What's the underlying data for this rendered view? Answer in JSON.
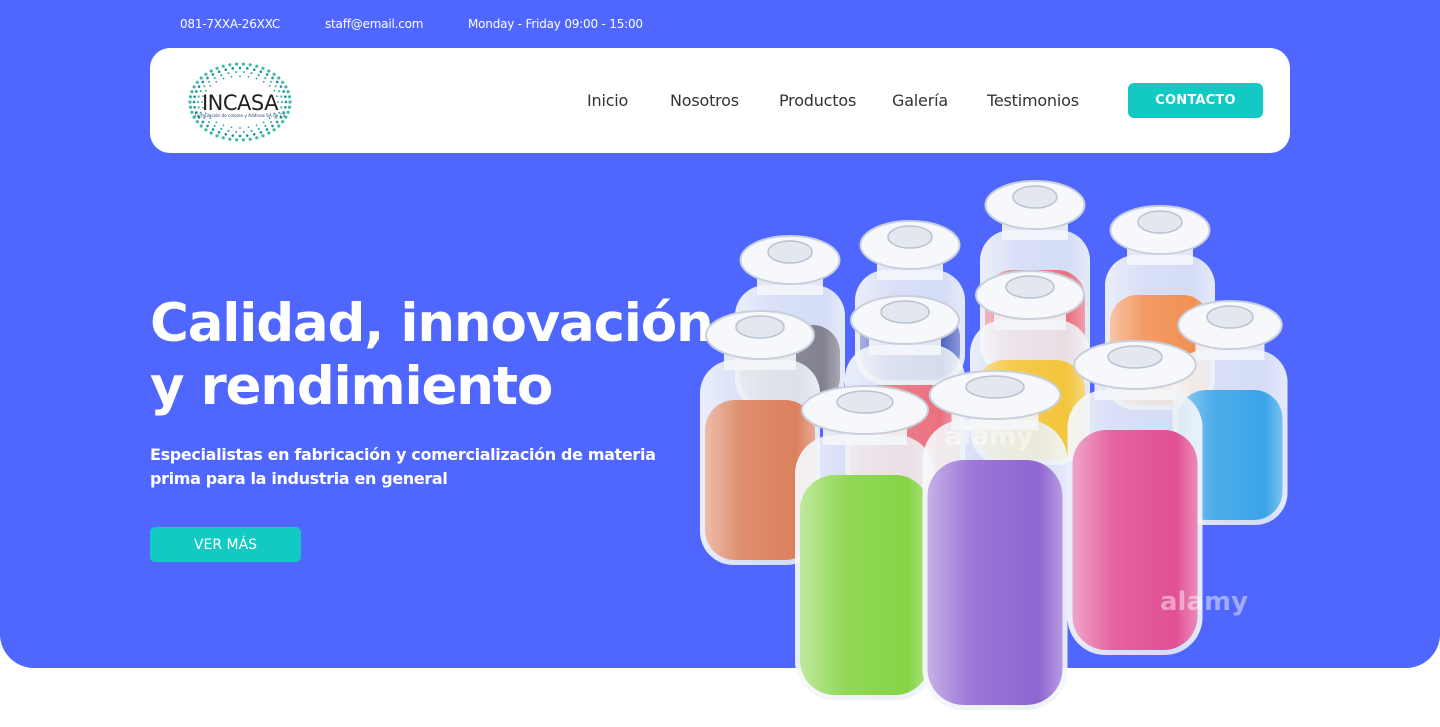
{
  "topbar": {
    "phone": "081-7XXA-26XXC",
    "email": "staff@email.com",
    "hours": "Monday - Friday 09:00 - 15:00"
  },
  "nav": {
    "logo_text": "INCASA",
    "logo_tagline": "Formulación de colores y Aditivos SA de CV",
    "links": [
      "Inicio",
      "Nosotros",
      "Productos",
      "Galería",
      "Testimonios"
    ],
    "contact_label": "CONTACTO"
  },
  "hero": {
    "headline_line1": "Calidad, innovación",
    "headline_line2": "y rendimiento",
    "subtitle_line1": "Especialistas en fabricación y comercialización de materia",
    "subtitle_line2": "prima para la industria en general",
    "cta_label": "VER MÁS",
    "image_alt": "Frascos de vidrio con pigmentos en polvo de colores",
    "watermark": "alamy"
  },
  "colors": {
    "brand_blue": "#4f66ff",
    "accent_teal": "#12c9c3",
    "pigments": [
      "#d97a55",
      "#7fd23a",
      "#8a5ed0",
      "#e0468f",
      "#2f9fe6",
      "#f2c230",
      "#f08a4a",
      "#7a7a8a",
      "#4a5fc0",
      "#e86a7a"
    ]
  }
}
